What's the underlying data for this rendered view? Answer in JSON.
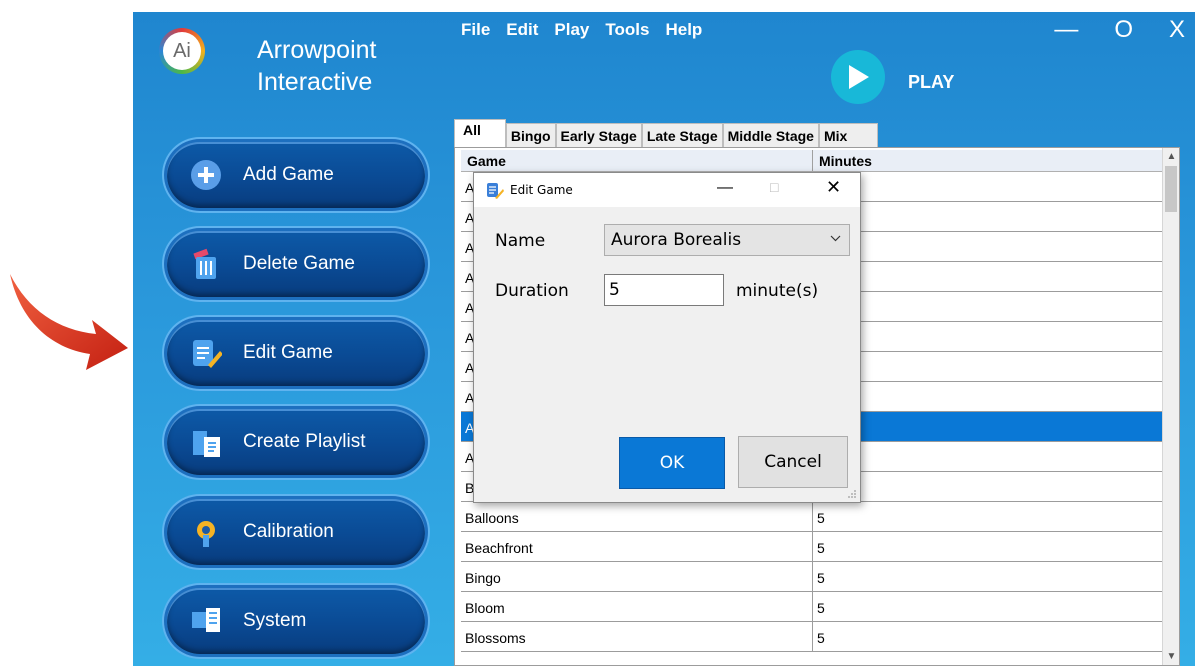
{
  "brand": {
    "logo_text": "Ai",
    "name_line1": "Arrowpoint",
    "name_line2": "Interactive"
  },
  "menu": [
    "File",
    "Edit",
    "Play",
    "Tools",
    "Help"
  ],
  "window_controls": {
    "minimize": "—",
    "maximize": "O",
    "close": "X"
  },
  "play": {
    "label": "PLAY"
  },
  "sidebar": {
    "items": [
      {
        "label": "Add Game",
        "icon": "plus-icon"
      },
      {
        "label": "Delete Game",
        "icon": "trash-icon"
      },
      {
        "label": "Edit Game",
        "icon": "edit-icon"
      },
      {
        "label": "Create Playlist",
        "icon": "playlist-icon"
      },
      {
        "label": "Calibration",
        "icon": "wrench-icon"
      },
      {
        "label": "System",
        "icon": "system-icon"
      }
    ]
  },
  "tabs": [
    "All",
    "Bingo",
    "Early Stage",
    "Late Stage",
    "Middle Stage",
    "Mix"
  ],
  "grid": {
    "columns": [
      "Game",
      "Minutes"
    ],
    "rows": [
      {
        "game": "A",
        "minutes": ""
      },
      {
        "game": "A",
        "minutes": ""
      },
      {
        "game": "A",
        "minutes": ""
      },
      {
        "game": "A",
        "minutes": ""
      },
      {
        "game": "A",
        "minutes": ""
      },
      {
        "game": "A",
        "minutes": ""
      },
      {
        "game": "A",
        "minutes": ""
      },
      {
        "game": "A",
        "minutes": ""
      },
      {
        "game": "A",
        "minutes": "",
        "selected": true
      },
      {
        "game": "A",
        "minutes": ""
      },
      {
        "game": "B",
        "minutes": ""
      },
      {
        "game": "Balloons",
        "minutes": "5"
      },
      {
        "game": "Beachfront",
        "minutes": "5"
      },
      {
        "game": "Bingo",
        "minutes": "5"
      },
      {
        "game": "Bloom",
        "minutes": "5"
      },
      {
        "game": "Blossoms",
        "minutes": "5"
      }
    ]
  },
  "dialog": {
    "title": "Edit Game",
    "min": "—",
    "max": "□",
    "close": "✕",
    "name_label": "Name",
    "name_value": "Aurora Borealis",
    "duration_label": "Duration",
    "duration_value": "5",
    "duration_unit": "minute(s)",
    "ok_label": "OK",
    "cancel_label": "Cancel"
  },
  "colors": {
    "app_bg": "#2a98db",
    "selection": "#0a78d6",
    "play_accent": "#18b8d8",
    "arrow": "#e03a2a"
  }
}
